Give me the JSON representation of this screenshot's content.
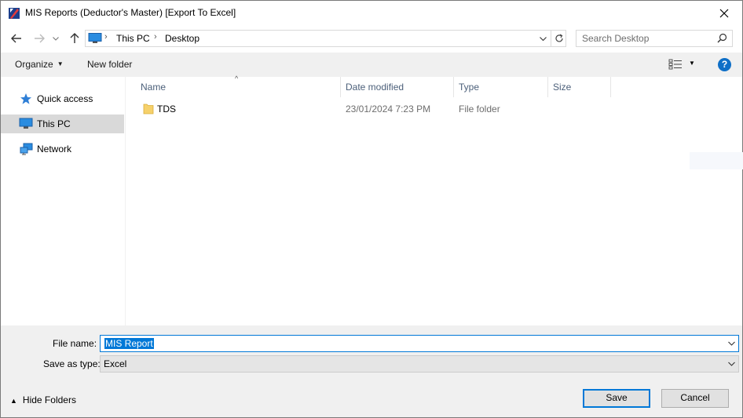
{
  "window": {
    "title": "MIS Reports (Deductor's Master) [Export To Excel]"
  },
  "address": {
    "crumbs": [
      "This PC",
      "Desktop"
    ]
  },
  "search": {
    "placeholder": "Search Desktop"
  },
  "toolbar": {
    "organize_label": "Organize",
    "new_folder_label": "New folder"
  },
  "nav": {
    "items": [
      {
        "label": "Quick access",
        "icon": "star-icon"
      },
      {
        "label": "This PC",
        "icon": "computer-icon",
        "selected": true
      },
      {
        "label": "Network",
        "icon": "network-icon"
      }
    ]
  },
  "columns": {
    "name": "Name",
    "date": "Date modified",
    "type": "Type",
    "size": "Size"
  },
  "files": [
    {
      "name": "TDS",
      "date": "23/01/2024 7:23 PM",
      "type": "File folder",
      "size": ""
    }
  ],
  "form": {
    "filename_label": "File name:",
    "filename_value": "MIS Report",
    "savetype_label": "Save as type:",
    "savetype_value": "Excel"
  },
  "footer": {
    "hide_folders_label": "Hide Folders",
    "save_label": "Save",
    "cancel_label": "Cancel"
  },
  "colors": {
    "accent": "#0078d7",
    "help": "#0e6fc7",
    "selection": "#d9d9d9",
    "folder": "#f6d16b"
  }
}
